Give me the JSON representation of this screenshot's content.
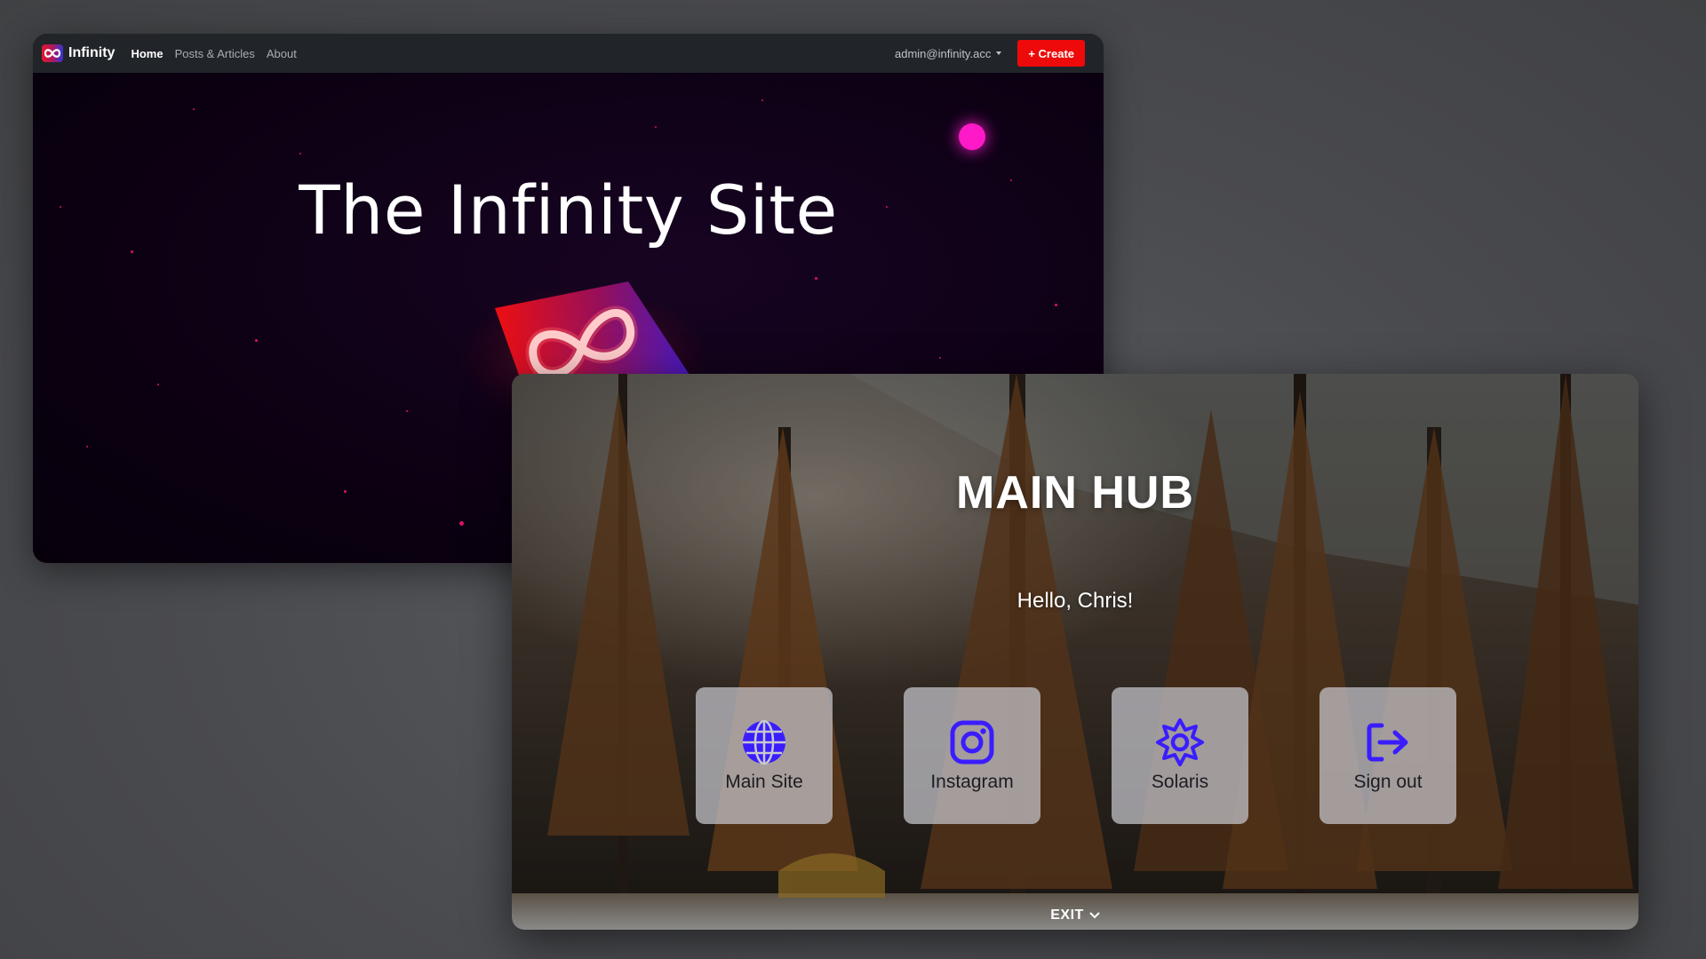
{
  "site": {
    "brand": "Infinity",
    "nav": [
      {
        "label": "Home",
        "active": true
      },
      {
        "label": "Posts & Articles",
        "active": false
      },
      {
        "label": "About",
        "active": false
      }
    ],
    "account": "admin@infinity.acc",
    "create_label": "+ Create",
    "hero_title": "The Infinity Site",
    "colors": {
      "navbar": "#212529",
      "create": "#ee0a0a",
      "accent_pink": "#ff19c8"
    }
  },
  "hub": {
    "title": "MAIN HUB",
    "greeting": "Hello, Chris!",
    "tiles": [
      {
        "label": "Main Site",
        "icon": "globe-icon"
      },
      {
        "label": "Instagram",
        "icon": "instagram-icon"
      },
      {
        "label": "Solaris",
        "icon": "sun-icon"
      },
      {
        "label": "Sign out",
        "icon": "sign-out-icon"
      }
    ],
    "exit_label": "EXIT",
    "colors": {
      "icon": "#3a1dff",
      "tile_bg": "#c8c8ce"
    }
  }
}
